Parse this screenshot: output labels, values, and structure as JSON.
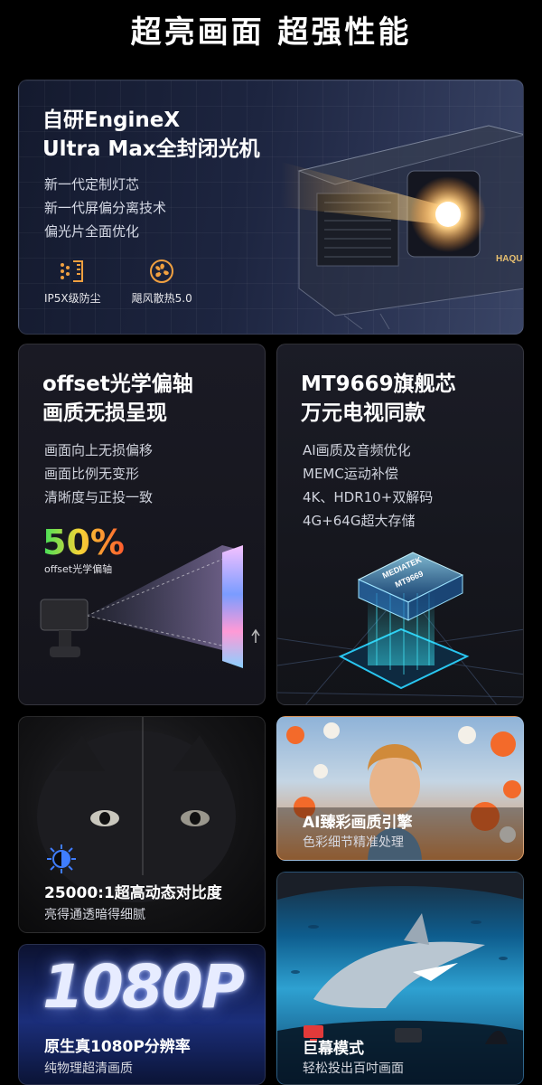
{
  "page_title": "超亮画面 超强性能",
  "engine": {
    "title_line1": "自研EngineX",
    "title_line2": "Ultra Max全封闭光机",
    "features": [
      "新一代定制灯芯",
      "新一代屏偏分离技术",
      "偏光片全面优化"
    ],
    "icons": [
      {
        "icon": "dust-icon",
        "label": "IP5X级防尘"
      },
      {
        "icon": "fan-icon",
        "label": "飓风散热5.0"
      }
    ],
    "brand_mark": "HAQU",
    "accent": "#f0a040"
  },
  "offset": {
    "title_line1": "offset光学偏轴",
    "title_line2": "画质无损呈现",
    "features": [
      "画面向上无损偏移",
      "画面比例无变形",
      "清晰度与正投一致"
    ],
    "percent": "50%",
    "percent_label": "offset光学偏轴"
  },
  "chip": {
    "title_line1": "MT9669旗舰芯",
    "title_line2": "万元电视同款",
    "features": [
      "AI画质及音频优化",
      "MEMC运动补偿",
      "4K、HDR10+双解码",
      "4G+64G超大存储"
    ],
    "chip_brand": "MEDIATEK",
    "chip_model": "MT9669",
    "accent": "#29c6f0"
  },
  "contrast": {
    "title": "25000:1超高动态对比度",
    "subtitle": "亮得通透暗得细腻"
  },
  "ai_color": {
    "title": "AI臻彩画质引擎",
    "subtitle": "色彩细节精准处理"
  },
  "resolution": {
    "big_text": "1080P",
    "title": "原生真1080P分辨率",
    "subtitle": "纯物理超清画质"
  },
  "giant_screen": {
    "title": "巨幕模式",
    "subtitle": "轻松投出百吋画面"
  }
}
